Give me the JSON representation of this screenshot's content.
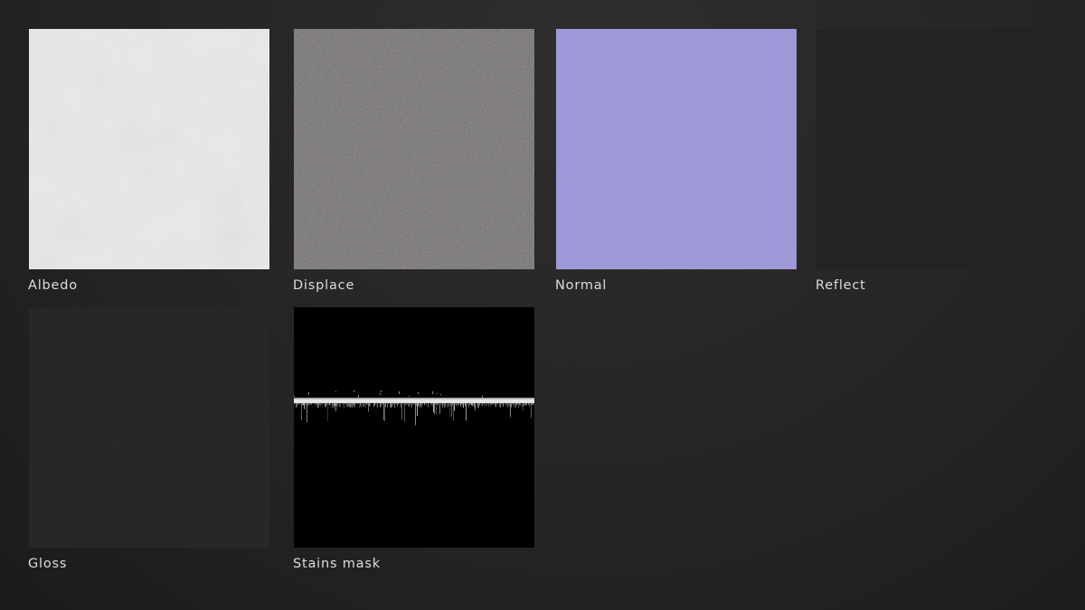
{
  "maps": [
    {
      "id": "albedo",
      "label": "Albedo",
      "color": "#e9e9e9"
    },
    {
      "id": "displace",
      "label": "Displace",
      "color": "#6e6b69"
    },
    {
      "id": "normal",
      "label": "Normal",
      "color": "#9c98d8"
    },
    {
      "id": "reflect",
      "label": "Reflect",
      "color": "#222021"
    },
    {
      "id": "gloss",
      "label": "Gloss",
      "color": "#262425"
    },
    {
      "id": "stains",
      "label": "Stains mask",
      "color": "#000000"
    }
  ]
}
